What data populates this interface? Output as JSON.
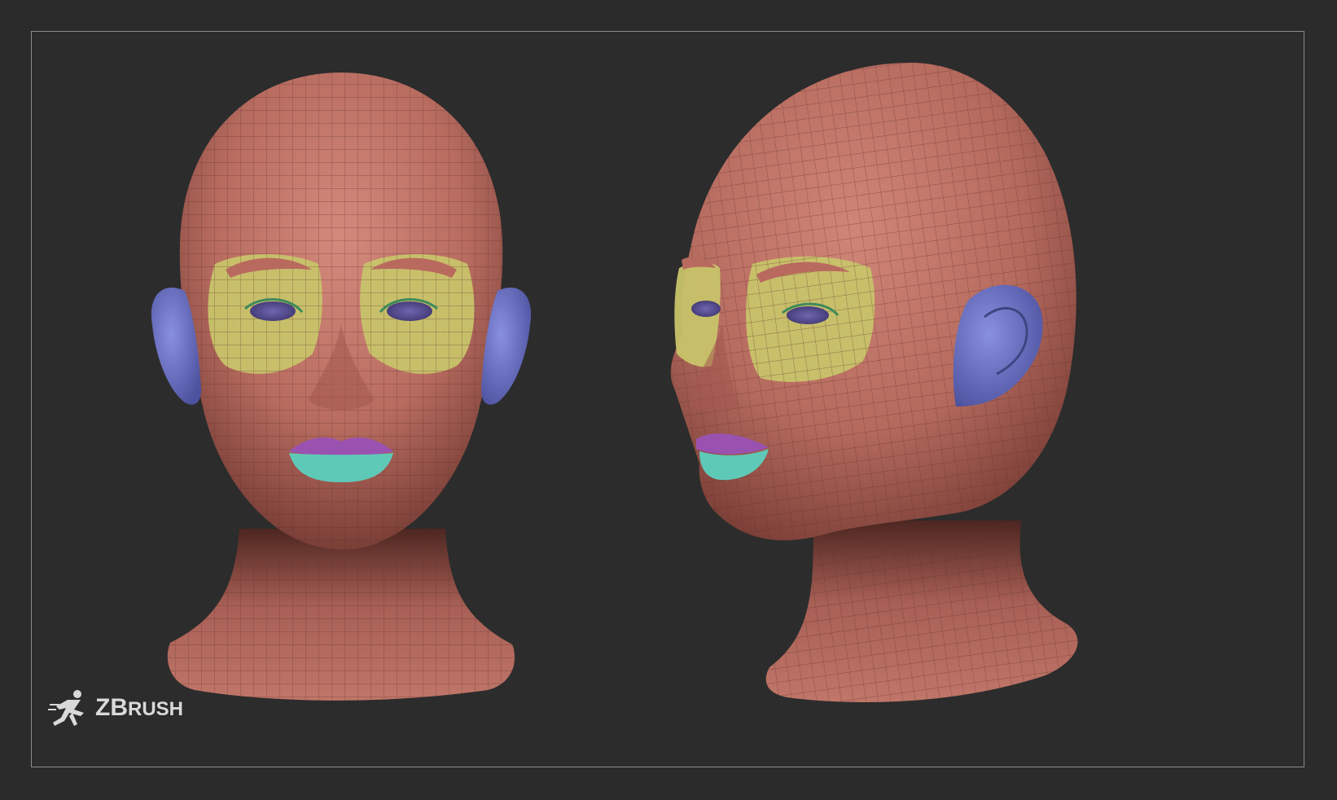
{
  "canvas": {
    "background": "#2b2b2b",
    "frame_color": "#8c8c8c",
    "colors": {
      "skin": "#c1776b",
      "skin_shadow": "#6e3a33",
      "wire": "#5a3029",
      "ears": "#6d74c9",
      "eye_patch": "#c8c36a",
      "brows": "#b96a5e",
      "eyeballs": "#5b5299",
      "upper_lip": "#9a52b0",
      "lower_lip": "#5fc9b8"
    }
  },
  "views": [
    {
      "name": "front-view"
    },
    {
      "name": "three-quarter-view"
    }
  ],
  "logo": {
    "icon": "running-figure-icon",
    "text_big": "ZB",
    "text_small": "RUSH"
  }
}
